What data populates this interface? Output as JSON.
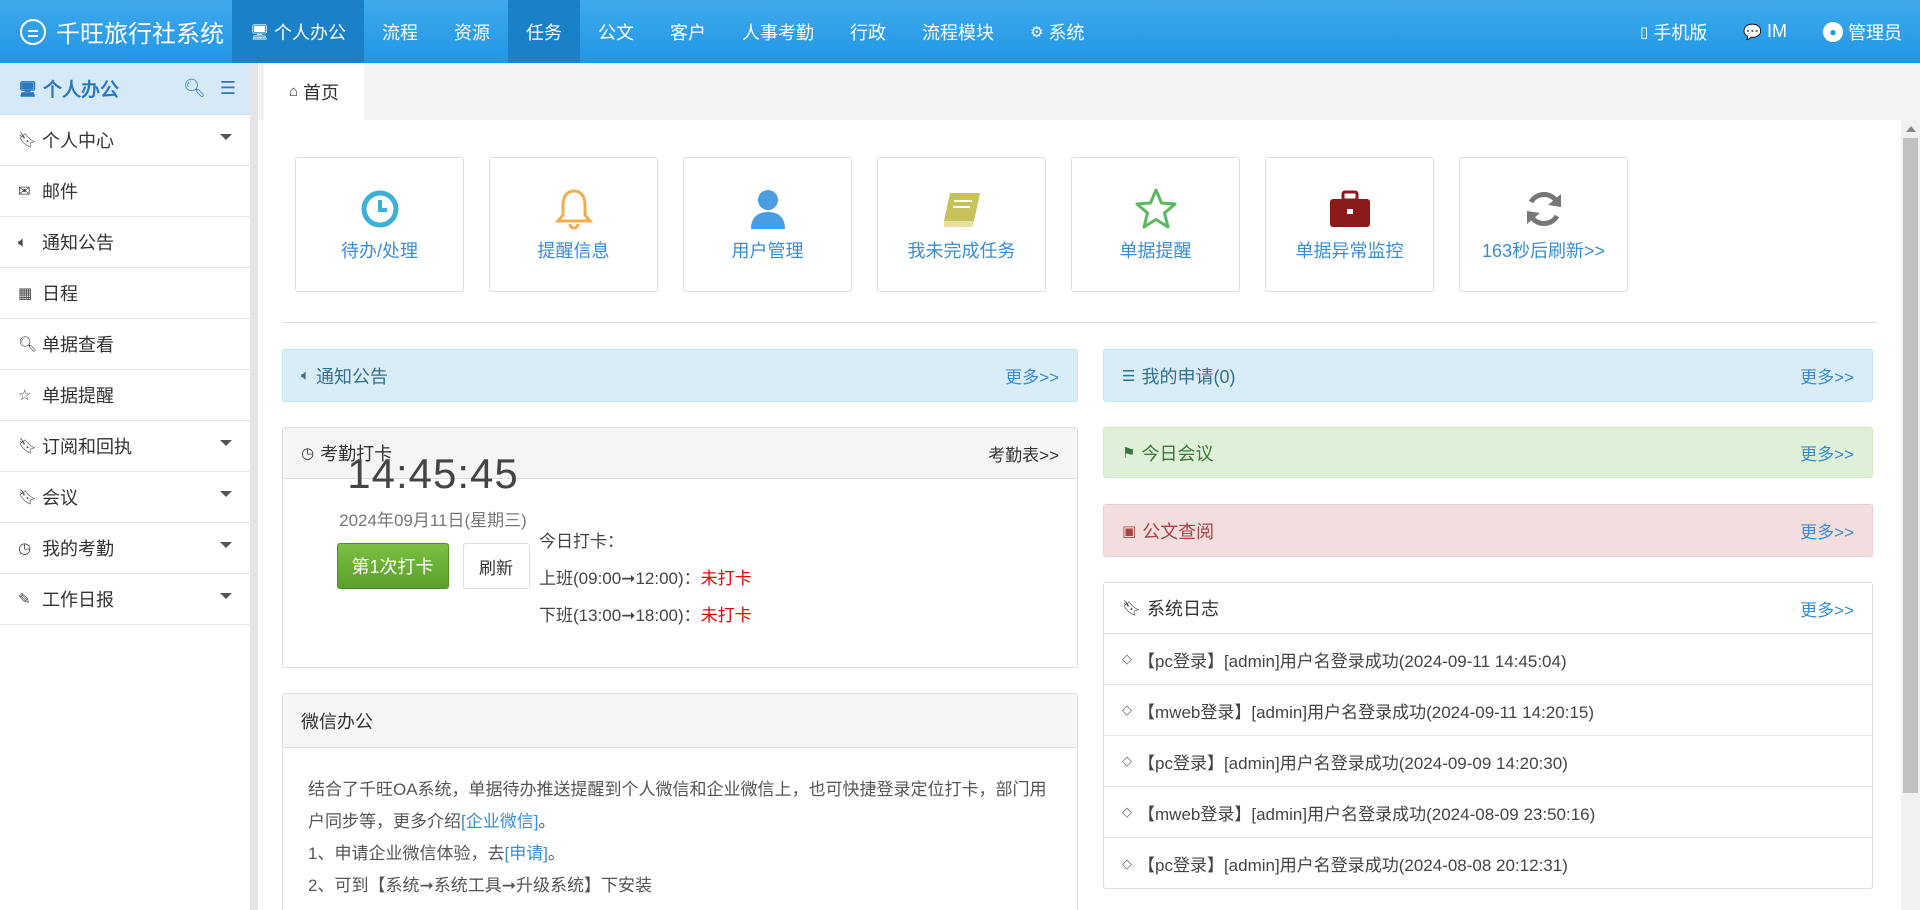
{
  "app": {
    "title": "千旺旅行社系统"
  },
  "nav": {
    "items": [
      {
        "label": "个人办公",
        "icon": "monitor-icon"
      },
      {
        "label": "流程"
      },
      {
        "label": "资源"
      },
      {
        "label": "任务"
      },
      {
        "label": "公文"
      },
      {
        "label": "客户"
      },
      {
        "label": "人事考勤"
      },
      {
        "label": "行政"
      },
      {
        "label": "流程模块"
      },
      {
        "label": "系统",
        "icon": "gear-icon"
      }
    ],
    "right": {
      "mobile": "手机版",
      "im": "IM",
      "user": "管理员"
    }
  },
  "sidebar": {
    "title": "个人办公",
    "items": [
      {
        "label": "个人中心",
        "icon": "bookmark-icon",
        "caret": true
      },
      {
        "label": "邮件",
        "icon": "envelope-icon"
      },
      {
        "label": "通知公告",
        "icon": "volume-icon"
      },
      {
        "label": "日程",
        "icon": "calendar-icon"
      },
      {
        "label": "单据查看",
        "icon": "search-icon"
      },
      {
        "label": "单据提醒",
        "icon": "star-icon"
      },
      {
        "label": "订阅和回执",
        "icon": "bookmark-icon",
        "caret": true
      },
      {
        "label": "会议",
        "icon": "bookmark-icon",
        "caret": true
      },
      {
        "label": "我的考勤",
        "icon": "clock-icon",
        "caret": true
      },
      {
        "label": "工作日报",
        "icon": "edit-icon",
        "caret": true
      }
    ]
  },
  "tab": {
    "label": "首页"
  },
  "tiles": [
    {
      "label": "待办/处理",
      "icon": "clock-icon",
      "color": "#3cb0d6"
    },
    {
      "label": "提醒信息",
      "icon": "bell-icon",
      "color": "#f0ad4e"
    },
    {
      "label": "用户管理",
      "icon": "user-icon",
      "color": "#4a9de0"
    },
    {
      "label": "我未完成任务",
      "icon": "book-icon",
      "color": "#c8c25a"
    },
    {
      "label": "单据提醒",
      "icon": "star-icon",
      "color": "#5cb85c"
    },
    {
      "label": "单据异常监控",
      "icon": "briefcase-icon",
      "color": "#8b1a1a"
    },
    {
      "label": "163秒后刷新>>",
      "icon": "refresh-icon",
      "color": "#777777"
    }
  ],
  "notice": {
    "title": "通知公告",
    "more": "更多>>"
  },
  "attendance": {
    "title": "考勤打卡",
    "more": "考勤表>>",
    "time": "14:45:45",
    "date": "2024年09月11日(星期三)",
    "punch_btn": "第1次打卡",
    "refresh_btn": "刷新",
    "today_label": "今日打卡：",
    "shift1_label": "上班(09:00➞12:00)：",
    "shift1_status": "未打卡",
    "shift2_label": "下班(13:00➞18:00)：",
    "shift2_status": "未打卡"
  },
  "wechat": {
    "title": "微信办公",
    "p1a": "结合了千旺OA系统，单据待办推送提醒到个人微信和企业微信上，也可快捷登录定位打卡，部门用户同步等，更多介绍",
    "p1_link": "[企业微信]",
    "p1b": "。",
    "p2a": "1、申请企业微信体验，去",
    "p2_link": "[申请]",
    "p2b": "。",
    "p3": "2、可到【系统➞系统工具➞升级系统】下安装"
  },
  "my_apply": {
    "title": "我的申请(0)",
    "more": "更多>>"
  },
  "meeting": {
    "title": "今日会议",
    "more": "更多>>"
  },
  "doc_query": {
    "title": "公文查阅",
    "more": "更多>>"
  },
  "syslog": {
    "title": "系统日志",
    "more": "更多>>",
    "rows": [
      "【pc登录】[admin]用户名登录成功(2024-09-11 14:45:04)",
      "【mweb登录】[admin]用户名登录成功(2024-09-11 14:20:15)",
      "【pc登录】[admin]用户名登录成功(2024-09-09 14:20:30)",
      "【mweb登录】[admin]用户名登录成功(2024-08-09 23:50:16)",
      "【pc登录】[admin]用户名登录成功(2024-08-08 20:12:31)"
    ]
  }
}
